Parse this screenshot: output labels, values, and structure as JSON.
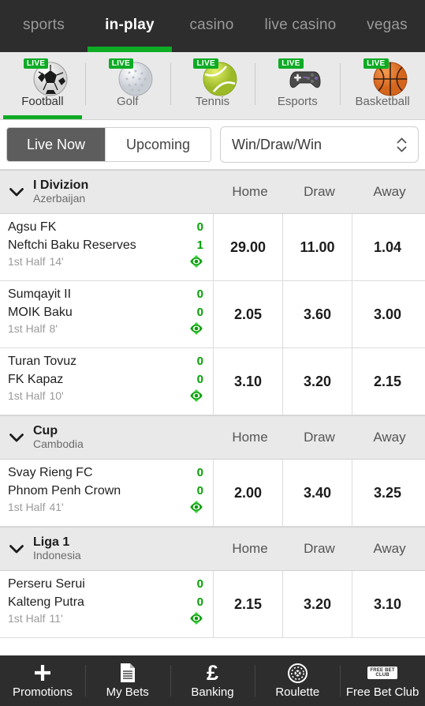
{
  "topnav": {
    "tabs": [
      {
        "label": "sports",
        "active": false
      },
      {
        "label": "in-play",
        "active": true
      },
      {
        "label": "casino",
        "active": false
      },
      {
        "label": "live casino",
        "active": false
      },
      {
        "label": "vegas",
        "active": false
      }
    ],
    "active_accent": "#0eab25",
    "background": "#2d2d2d"
  },
  "sports_strip": {
    "live_badge_label": "LIVE",
    "items": [
      {
        "label": "Football",
        "icon": "football-icon",
        "live": true,
        "active": true
      },
      {
        "label": "Golf",
        "icon": "golf-ball-icon",
        "live": true,
        "active": false
      },
      {
        "label": "Tennis",
        "icon": "tennis-ball-icon",
        "live": true,
        "active": false
      },
      {
        "label": "Esports",
        "icon": "gamepad-icon",
        "live": true,
        "active": false
      },
      {
        "label": "Basketball",
        "icon": "basketball-icon",
        "live": true,
        "active": false
      }
    ]
  },
  "filterbar": {
    "live_now_label": "Live Now",
    "upcoming_label": "Upcoming",
    "selected": "Live Now",
    "market_select_value": "Win/Draw/Win",
    "market_select_icon": "chevron-up-down-icon"
  },
  "columns": {
    "home": "Home",
    "draw": "Draw",
    "away": "Away"
  },
  "leagues": [
    {
      "name": "I Divizion",
      "country": "Azerbaijan",
      "collapse_icon": "chevron-down-icon",
      "matches": [
        {
          "home_team": "Agsu FK",
          "home_score": "0",
          "away_team": "Neftchi Baku Reserves",
          "away_score": "1",
          "period": "1st Half",
          "minute": "14'",
          "stream_icon": "live-stream-icon",
          "odds": {
            "home": "29.00",
            "draw": "11.00",
            "away": "1.04"
          }
        },
        {
          "home_team": "Sumqayit II",
          "home_score": "0",
          "away_team": "MOIK Baku",
          "away_score": "0",
          "period": "1st Half",
          "minute": "8'",
          "stream_icon": "live-stream-icon",
          "odds": {
            "home": "2.05",
            "draw": "3.60",
            "away": "3.00"
          }
        },
        {
          "home_team": "Turan Tovuz",
          "home_score": "0",
          "away_team": "FK Kapaz",
          "away_score": "0",
          "period": "1st Half",
          "minute": "10'",
          "stream_icon": "live-stream-icon",
          "odds": {
            "home": "3.10",
            "draw": "3.20",
            "away": "2.15"
          }
        }
      ]
    },
    {
      "name": "Cup",
      "country": "Cambodia",
      "collapse_icon": "chevron-down-icon",
      "matches": [
        {
          "home_team": "Svay Rieng FC",
          "home_score": "0",
          "away_team": "Phnom Penh Crown",
          "away_score": "0",
          "period": "1st Half",
          "minute": "41'",
          "stream_icon": "live-stream-icon",
          "odds": {
            "home": "2.00",
            "draw": "3.40",
            "away": "3.25"
          }
        }
      ]
    },
    {
      "name": "Liga 1",
      "country": "Indonesia",
      "collapse_icon": "chevron-down-icon",
      "matches": [
        {
          "home_team": "Perseru Serui",
          "home_score": "0",
          "away_team": "Kalteng Putra",
          "away_score": "0",
          "period": "1st Half",
          "minute": "11'",
          "stream_icon": "live-stream-icon",
          "odds": {
            "home": "2.15",
            "draw": "3.20",
            "away": "3.10"
          }
        }
      ]
    }
  ],
  "bottomnav": {
    "items": [
      {
        "label": "Promotions",
        "icon": "plus-icon"
      },
      {
        "label": "My Bets",
        "icon": "document-icon"
      },
      {
        "label": "Banking",
        "icon": "pound-sterling-icon"
      },
      {
        "label": "Roulette",
        "icon": "roulette-wheel-icon"
      },
      {
        "label": "Free Bet Club",
        "icon": "free-bet-club-badge-icon"
      }
    ],
    "free_bet_club_badge_line1": "FREE BET",
    "free_bet_club_badge_line2": "CLUB"
  }
}
